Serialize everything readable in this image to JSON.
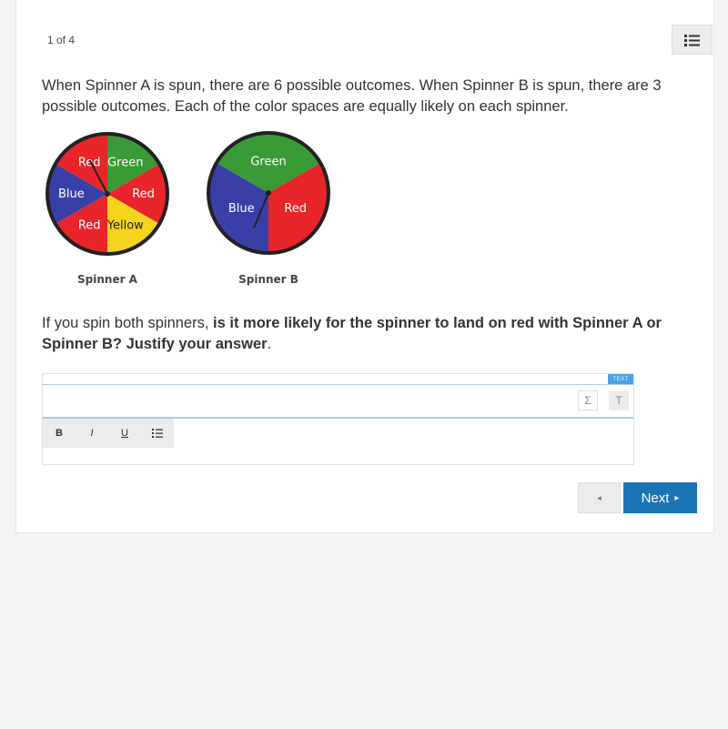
{
  "header": {
    "counter": "1 of 4"
  },
  "question": {
    "intro": "When Spinner A is spun, there are 6 possible outcomes.  When Spinner B is spun, there are 3 possible outcomes.  Each of the color spaces are equally likely on each spinner.",
    "prompt_plain": "If you spin both spinners, ",
    "prompt_bold": "is it more likely for the spinner to land on red with Spinner A or Spinner B?  Justify your answer",
    "prompt_end": "."
  },
  "spinners": [
    {
      "caption": "Spinner A",
      "sectors": [
        {
          "label": "Green",
          "color": "#3a9a35"
        },
        {
          "label": "Red",
          "color": "#e8252a"
        },
        {
          "label": "Yellow",
          "color": "#f4d41c"
        },
        {
          "label": "Red",
          "color": "#e8252a"
        },
        {
          "label": "Blue",
          "color": "#3a3fa8"
        },
        {
          "label": "Red",
          "color": "#e8252a"
        }
      ]
    },
    {
      "caption": "Spinner B",
      "sectors": [
        {
          "label": "Green",
          "color": "#3a9a35"
        },
        {
          "label": "Red",
          "color": "#e8252a"
        },
        {
          "label": "Blue",
          "color": "#3a3fa8"
        }
      ]
    }
  ],
  "editor": {
    "mode_tag": "TEXT",
    "sigma": "Σ",
    "text_mode": "T",
    "bold": "B",
    "italic": "I",
    "underline": "U",
    "list_icon": "list-icon"
  },
  "nav": {
    "prev": "◂",
    "next": "Next",
    "next_arrow": "▸"
  },
  "colors": {
    "accent": "#1b75b5",
    "tag": "#4aa3e6"
  }
}
